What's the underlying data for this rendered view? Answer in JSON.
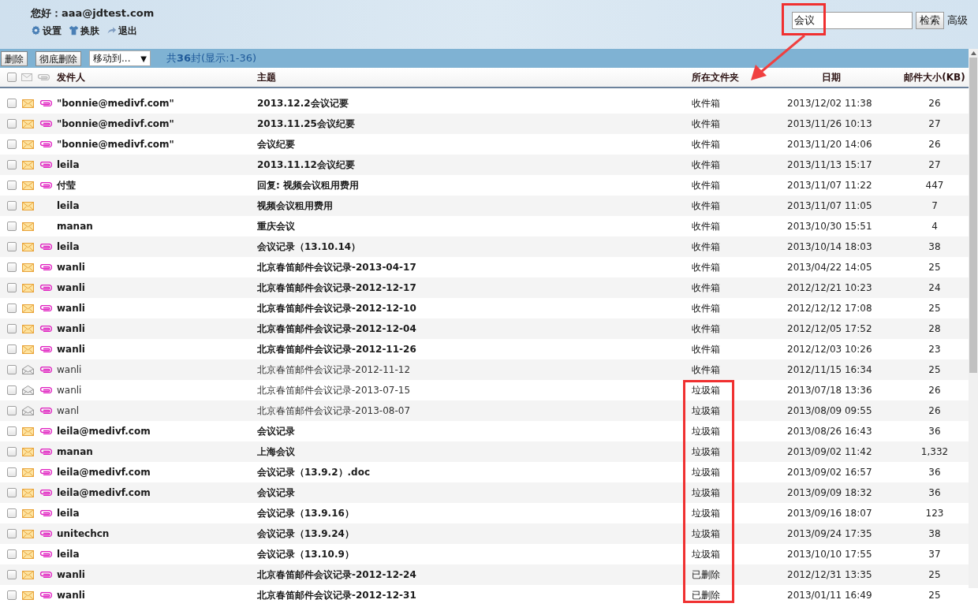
{
  "header": {
    "greeting": "您好：aaa@jdtest.com",
    "links": [
      {
        "label": "设置",
        "kind": "settings"
      },
      {
        "label": "换肤",
        "kind": "skin"
      },
      {
        "label": "退出",
        "kind": "logout"
      }
    ],
    "search": {
      "value": "会议",
      "button": "检索",
      "advanced": "高级"
    }
  },
  "toolbar": {
    "buttons": [
      "删除",
      "彻底删除"
    ],
    "move_select": "移动到...",
    "arrow": "▼",
    "count_prefix": "共",
    "count": "36",
    "count_suffix": "封(显示:1-36)"
  },
  "table": {
    "select_all_checked": false,
    "columns": [
      "发件人",
      "主题",
      "所在文件夹",
      "日期",
      "邮件大小(KB)"
    ],
    "rows": [
      {
        "checked": false,
        "unread": true,
        "attachment": true,
        "sender": "\"bonnie@medivf.com\"",
        "subject": "2013.12.2会议记要",
        "folder": "收件箱",
        "date": "2013/12/02 11:38",
        "size": "26"
      },
      {
        "checked": false,
        "unread": true,
        "attachment": true,
        "sender": "\"bonnie@medivf.com\"",
        "subject": "2013.11.25会议纪要",
        "folder": "收件箱",
        "date": "2013/11/26 10:13",
        "size": "27"
      },
      {
        "checked": false,
        "unread": true,
        "attachment": true,
        "sender": "\"bonnie@medivf.com\"",
        "subject": "会议纪要",
        "folder": "收件箱",
        "date": "2013/11/20 14:06",
        "size": "26"
      },
      {
        "checked": false,
        "unread": true,
        "attachment": true,
        "sender": "leila",
        "subject": "2013.11.12会议纪要",
        "folder": "收件箱",
        "date": "2013/11/13 15:17",
        "size": "27"
      },
      {
        "checked": false,
        "unread": true,
        "attachment": true,
        "sender": "付莹",
        "subject": "回复: 视频会议租用费用",
        "folder": "收件箱",
        "date": "2013/11/07 11:22",
        "size": "447"
      },
      {
        "checked": false,
        "unread": true,
        "attachment": false,
        "sender": "leila",
        "subject": "视频会议租用费用",
        "folder": "收件箱",
        "date": "2013/11/07 11:05",
        "size": "7"
      },
      {
        "checked": false,
        "unread": true,
        "attachment": false,
        "sender": "manan",
        "subject": "重庆会议",
        "folder": "收件箱",
        "date": "2013/10/30 15:51",
        "size": "4"
      },
      {
        "checked": false,
        "unread": true,
        "attachment": true,
        "sender": "leila",
        "subject": "会议记录（13.10.14）",
        "folder": "收件箱",
        "date": "2013/10/14 18:03",
        "size": "38"
      },
      {
        "checked": false,
        "unread": true,
        "attachment": true,
        "sender": "wanli",
        "subject": "北京春笛邮件会议记录-2013-04-17",
        "folder": "收件箱",
        "date": "2013/04/22 14:05",
        "size": "25"
      },
      {
        "checked": false,
        "unread": true,
        "attachment": true,
        "sender": "wanli",
        "subject": "北京春笛邮件会议记录-2012-12-17",
        "folder": "收件箱",
        "date": "2012/12/21 10:23",
        "size": "24"
      },
      {
        "checked": false,
        "unread": true,
        "attachment": true,
        "sender": "wanli",
        "subject": "北京春笛邮件会议记录-2012-12-10",
        "folder": "收件箱",
        "date": "2012/12/12 17:08",
        "size": "25"
      },
      {
        "checked": false,
        "unread": true,
        "attachment": true,
        "sender": "wanli",
        "subject": "北京春笛邮件会议记录-2012-12-04",
        "folder": "收件箱",
        "date": "2012/12/05 17:52",
        "size": "28"
      },
      {
        "checked": false,
        "unread": true,
        "attachment": true,
        "sender": "wanli",
        "subject": "北京春笛邮件会议记录-2012-11-26",
        "folder": "收件箱",
        "date": "2012/12/03 10:26",
        "size": "23"
      },
      {
        "checked": false,
        "unread": false,
        "attachment": true,
        "sender": "wanli",
        "subject": "北京春笛邮件会议记录-2012-11-12",
        "folder": "收件箱",
        "date": "2012/11/15 16:34",
        "size": "25"
      },
      {
        "checked": false,
        "unread": false,
        "attachment": true,
        "sender": "wanli",
        "subject": "北京春笛邮件会议记录-2013-07-15",
        "folder": "垃圾箱",
        "date": "2013/07/18 13:36",
        "size": "26"
      },
      {
        "checked": false,
        "unread": false,
        "attachment": true,
        "sender": "wanl",
        "subject": "北京春笛邮件会议记录-2013-08-07",
        "folder": "垃圾箱",
        "date": "2013/08/09 09:55",
        "size": "26"
      },
      {
        "checked": false,
        "unread": true,
        "attachment": true,
        "sender": "leila@medivf.com",
        "subject": "会议记录",
        "folder": "垃圾箱",
        "date": "2013/08/26 16:43",
        "size": "36"
      },
      {
        "checked": false,
        "unread": true,
        "attachment": true,
        "sender": "manan",
        "subject": "上海会议",
        "folder": "垃圾箱",
        "date": "2013/09/02 11:42",
        "size": "1,332"
      },
      {
        "checked": false,
        "unread": true,
        "attachment": true,
        "sender": "leila@medivf.com",
        "subject": "会议记录（13.9.2）.doc",
        "folder": "垃圾箱",
        "date": "2013/09/02 16:57",
        "size": "36"
      },
      {
        "checked": false,
        "unread": true,
        "attachment": true,
        "sender": "leila@medivf.com",
        "subject": "会议记录",
        "folder": "垃圾箱",
        "date": "2013/09/09 18:32",
        "size": "36"
      },
      {
        "checked": false,
        "unread": true,
        "attachment": true,
        "sender": "leila",
        "subject": "会议记录（13.9.16）",
        "folder": "垃圾箱",
        "date": "2013/09/16 18:07",
        "size": "123"
      },
      {
        "checked": false,
        "unread": true,
        "attachment": true,
        "sender": "unitechcn",
        "subject": "会议记录（13.9.24）",
        "folder": "垃圾箱",
        "date": "2013/09/24 17:35",
        "size": "38"
      },
      {
        "checked": false,
        "unread": true,
        "attachment": true,
        "sender": "leila",
        "subject": "会议记录（13.10.9）",
        "folder": "垃圾箱",
        "date": "2013/10/10 17:55",
        "size": "37"
      },
      {
        "checked": false,
        "unread": true,
        "attachment": true,
        "sender": "wanli",
        "subject": "北京春笛邮件会议记录-2012-12-24",
        "folder": "已删除",
        "date": "2012/12/31 13:35",
        "size": "25"
      },
      {
        "checked": false,
        "unread": true,
        "attachment": true,
        "sender": "wanli",
        "subject": "北京春笛邮件会议记录-2012-12-31",
        "folder": "已删除",
        "date": "2013/01/11 16:49",
        "size": "25"
      }
    ]
  }
}
